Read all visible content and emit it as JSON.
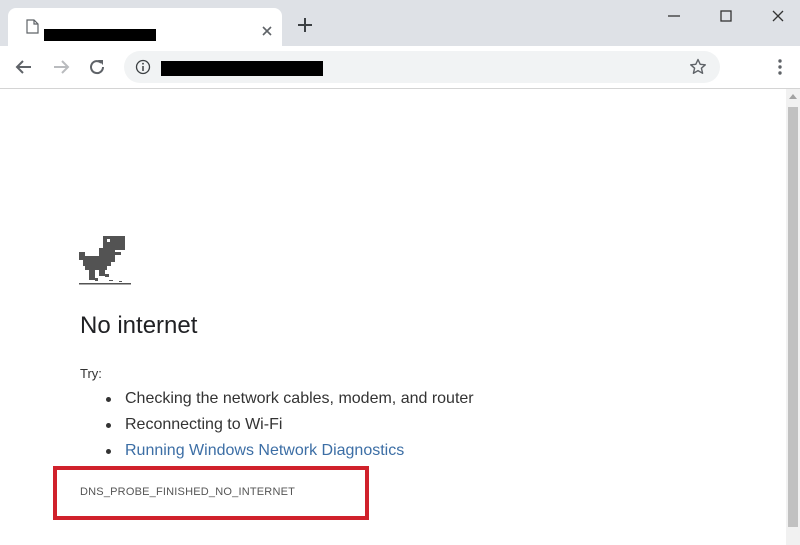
{
  "browser": {
    "tab": {
      "favicon_icon": "page-icon",
      "close_icon": "close-icon"
    },
    "new_tab_icon": "plus-icon",
    "window_controls": [
      "minimize-icon",
      "maximize-icon",
      "close-icon"
    ],
    "toolbar": {
      "icons": [
        "back-arrow-icon",
        "forward-arrow-icon",
        "reload-icon",
        "info-icon",
        "star-icon",
        "kebab-menu-icon"
      ]
    }
  },
  "page": {
    "icon": "dinosaur-icon",
    "heading": "No internet",
    "try_label": "Try:",
    "suggestions": [
      "Checking the network cables, modem, and router",
      "Reconnecting to Wi-Fi"
    ],
    "diagnostics_link": "Running Windows Network Diagnostics",
    "error_code": "DNS_PROBE_FINISHED_NO_INTERNET"
  },
  "colors": {
    "tabstrip": "#dee1e6",
    "link": "#3c6ea5",
    "highlight_border": "#d0212b",
    "text": "#333333"
  }
}
